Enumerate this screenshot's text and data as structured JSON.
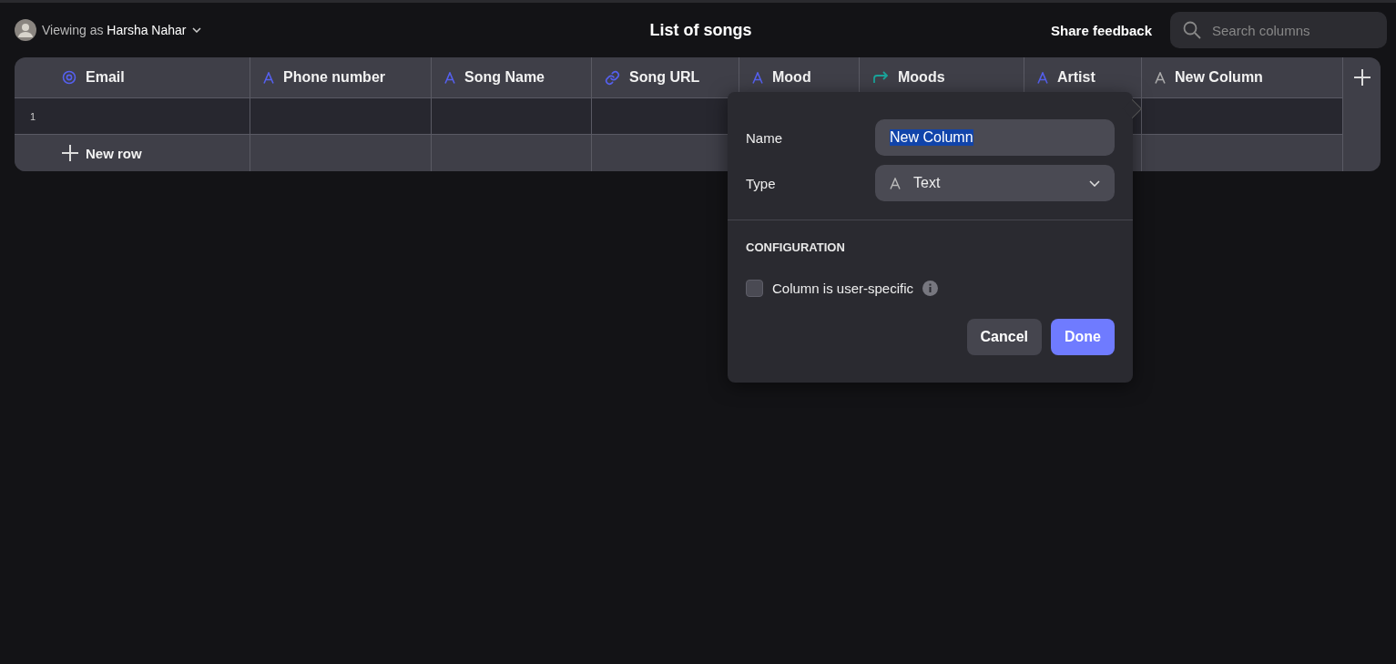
{
  "header": {
    "viewing_prefix": "Viewing as",
    "user": "Harsha Nahar",
    "title": "List of songs",
    "feedback": "Share feedback",
    "search": {
      "placeholder": "Search columns"
    }
  },
  "table": {
    "columns": [
      {
        "label": "Email",
        "kind": "email"
      },
      {
        "label": "Phone number",
        "kind": "text"
      },
      {
        "label": "Song Name",
        "kind": "text"
      },
      {
        "label": "Song URL",
        "kind": "link"
      },
      {
        "label": "Mood",
        "kind": "text"
      },
      {
        "label": "Moods",
        "kind": "relation"
      },
      {
        "label": "Artist",
        "kind": "text"
      },
      {
        "label": "New Column",
        "kind": "draft"
      }
    ],
    "rows": [
      {
        "number": "1"
      }
    ],
    "new_row": "New row"
  },
  "popover": {
    "name_label": "Name",
    "name_value": "New Column",
    "name_text_selected": true,
    "type_label": "Type",
    "type_value": "Text",
    "section": "CONFIGURATION",
    "user_specific": {
      "label": "Column is user-specific",
      "checked": false
    },
    "buttons": {
      "cancel": "Cancel",
      "done": "Done"
    }
  }
}
